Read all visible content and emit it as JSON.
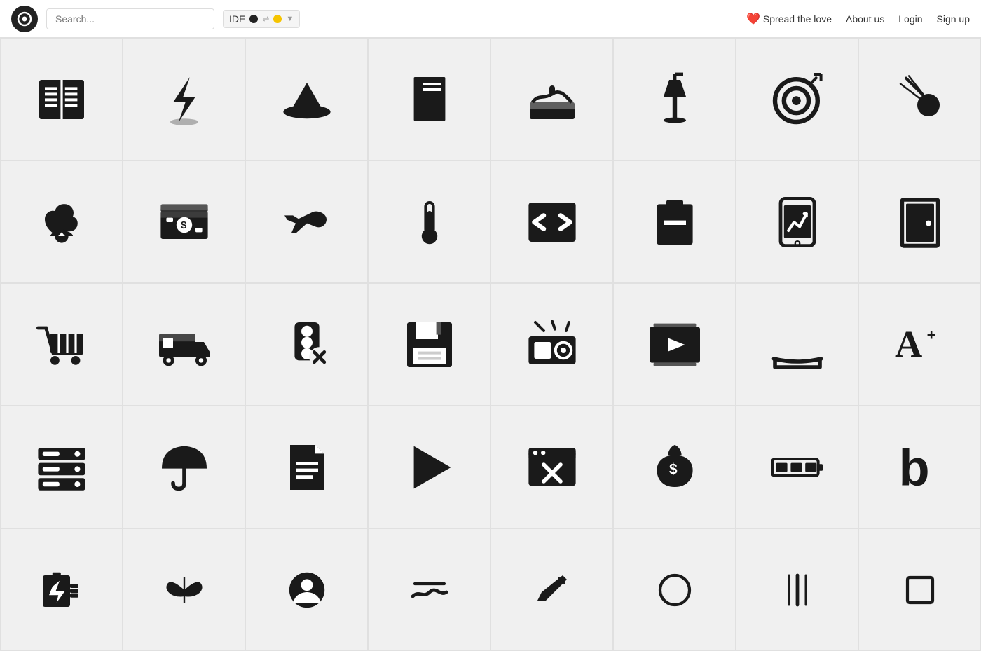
{
  "header": {
    "logo_text": "◎",
    "search_placeholder": "Search...",
    "tag_label": "IDE",
    "spread_love_label": "Spread the love",
    "about_us_label": "About us",
    "login_label": "Login",
    "signup_label": "Sign up"
  },
  "grid": {
    "rows": 5
  }
}
